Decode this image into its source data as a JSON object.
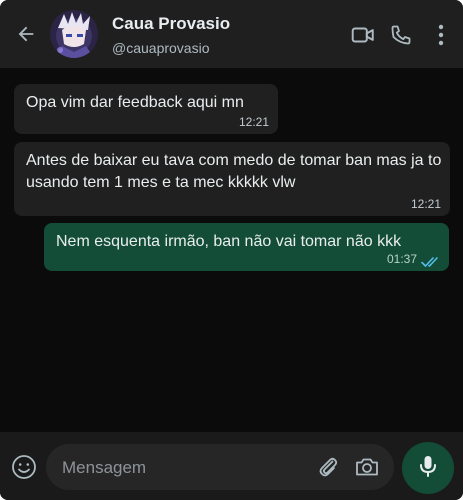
{
  "contact": {
    "name": "Caua Provasio",
    "handle": "@cauaprovasio"
  },
  "messages": [
    {
      "direction": "incoming",
      "text": "Opa vim dar feedback aqui mn",
      "time": "12:21"
    },
    {
      "direction": "incoming",
      "text": "Antes de baixar eu tava com medo de tomar ban mas ja to usando tem 1 mes e ta mec kkkkk vlw",
      "time": "12:21"
    },
    {
      "direction": "outgoing",
      "text": "Nem esquenta irmão, ban não vai tomar não kkk",
      "time": "01:37",
      "status": "read"
    }
  ],
  "composer": {
    "placeholder": "Mensagem"
  },
  "icons": {
    "back": "arrow-left-icon",
    "video": "video-call-icon",
    "call": "phone-icon",
    "menu": "more-vertical-icon",
    "emoji": "emoji-icon",
    "attach": "paperclip-icon",
    "camera": "camera-icon",
    "mic": "microphone-icon",
    "read": "double-check-icon"
  },
  "colors": {
    "header_bg": "#1f1f1f",
    "chat_bg": "#0b0b0b",
    "incoming_bubble": "#202020",
    "outgoing_bubble": "#134d37",
    "read_ticks": "#53bdeb",
    "mic_button": "#134d37"
  }
}
